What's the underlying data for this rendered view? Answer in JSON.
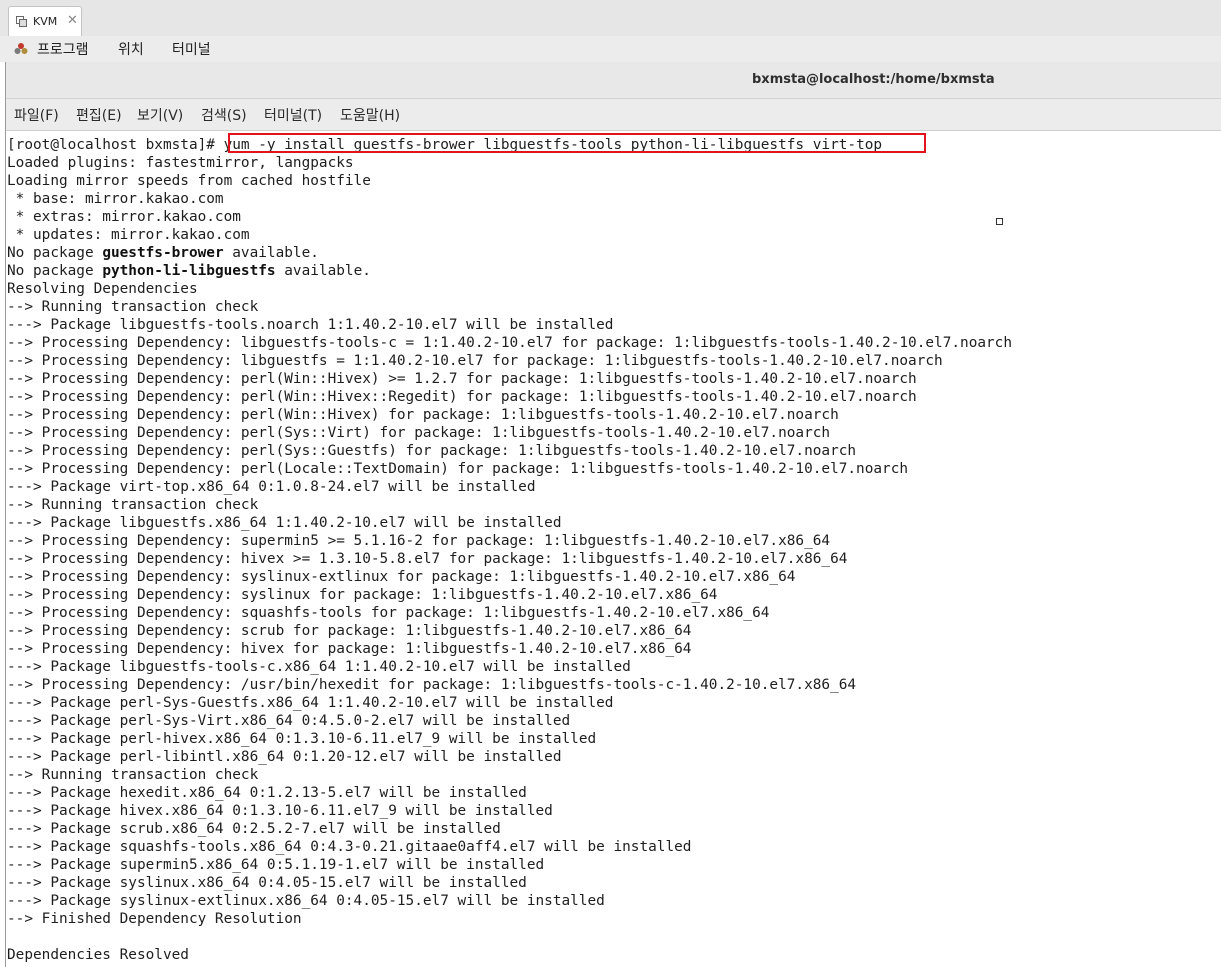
{
  "tab": {
    "title": "KVM",
    "close": "✕"
  },
  "topmenu": {
    "programs": "프로그램",
    "places": "위치",
    "terminal": "터미널"
  },
  "window": {
    "title": "bxmsta@localhost:/home/bxmsta"
  },
  "menubar": {
    "file": "파일(F)",
    "edit": "편집(E)",
    "view": "보기(V)",
    "search": "검색(S)",
    "terminal": "터미널(T)",
    "help": "도움말(H)"
  },
  "terminal": {
    "prompt": "[root@localhost bxmsta]#",
    "command": "yum -y install guestfs-brower libguestfs-tools python-li-libguestfs virt-top",
    "lines": [
      "Loaded plugins: fastestmirror, langpacks",
      "Loading mirror speeds from cached hostfile",
      " * base: mirror.kakao.com",
      " * extras: mirror.kakao.com",
      " * updates: mirror.kakao.com",
      "No package guestfs-brower available.",
      "No package python-li-libguestfs available.",
      "Resolving Dependencies",
      "--> Running transaction check",
      "---> Package libguestfs-tools.noarch 1:1.40.2-10.el7 will be installed",
      "--> Processing Dependency: libguestfs-tools-c = 1:1.40.2-10.el7 for package: 1:libguestfs-tools-1.40.2-10.el7.noarch",
      "--> Processing Dependency: libguestfs = 1:1.40.2-10.el7 for package: 1:libguestfs-tools-1.40.2-10.el7.noarch",
      "--> Processing Dependency: perl(Win::Hivex) >= 1.2.7 for package: 1:libguestfs-tools-1.40.2-10.el7.noarch",
      "--> Processing Dependency: perl(Win::Hivex::Regedit) for package: 1:libguestfs-tools-1.40.2-10.el7.noarch",
      "--> Processing Dependency: perl(Win::Hivex) for package: 1:libguestfs-tools-1.40.2-10.el7.noarch",
      "--> Processing Dependency: perl(Sys::Virt) for package: 1:libguestfs-tools-1.40.2-10.el7.noarch",
      "--> Processing Dependency: perl(Sys::Guestfs) for package: 1:libguestfs-tools-1.40.2-10.el7.noarch",
      "--> Processing Dependency: perl(Locale::TextDomain) for package: 1:libguestfs-tools-1.40.2-10.el7.noarch",
      "---> Package virt-top.x86_64 0:1.0.8-24.el7 will be installed",
      "--> Running transaction check",
      "---> Package libguestfs.x86_64 1:1.40.2-10.el7 will be installed",
      "--> Processing Dependency: supermin5 >= 5.1.16-2 for package: 1:libguestfs-1.40.2-10.el7.x86_64",
      "--> Processing Dependency: hivex >= 1.3.10-5.8.el7 for package: 1:libguestfs-1.40.2-10.el7.x86_64",
      "--> Processing Dependency: syslinux-extlinux for package: 1:libguestfs-1.40.2-10.el7.x86_64",
      "--> Processing Dependency: syslinux for package: 1:libguestfs-1.40.2-10.el7.x86_64",
      "--> Processing Dependency: squashfs-tools for package: 1:libguestfs-1.40.2-10.el7.x86_64",
      "--> Processing Dependency: scrub for package: 1:libguestfs-1.40.2-10.el7.x86_64",
      "--> Processing Dependency: hivex for package: 1:libguestfs-1.40.2-10.el7.x86_64",
      "---> Package libguestfs-tools-c.x86_64 1:1.40.2-10.el7 will be installed",
      "--> Processing Dependency: /usr/bin/hexedit for package: 1:libguestfs-tools-c-1.40.2-10.el7.x86_64",
      "---> Package perl-Sys-Guestfs.x86_64 1:1.40.2-10.el7 will be installed",
      "---> Package perl-Sys-Virt.x86_64 0:4.5.0-2.el7 will be installed",
      "---> Package perl-hivex.x86_64 0:1.3.10-6.11.el7_9 will be installed",
      "---> Package perl-libintl.x86_64 0:1.20-12.el7 will be installed",
      "--> Running transaction check",
      "---> Package hexedit.x86_64 0:1.2.13-5.el7 will be installed",
      "---> Package hivex.x86_64 0:1.3.10-6.11.el7_9 will be installed",
      "---> Package scrub.x86_64 0:2.5.2-7.el7 will be installed",
      "---> Package squashfs-tools.x86_64 0:4.3-0.21.gitaae0aff4.el7 will be installed",
      "---> Package supermin5.x86_64 0:5.1.19-1.el7 will be installed",
      "---> Package syslinux.x86_64 0:4.05-15.el7 will be installed",
      "---> Package syslinux-extlinux.x86_64 0:4.05-15.el7 will be installed",
      "--> Finished Dependency Resolution",
      "",
      "Dependencies Resolved"
    ],
    "bold_words": [
      "guestfs-brower",
      "python-li-libguestfs"
    ]
  },
  "colors": {
    "highlight_box": "#e1141e",
    "terminal_bg": "#ffffff",
    "terminal_fg": "#1e1e1e"
  }
}
